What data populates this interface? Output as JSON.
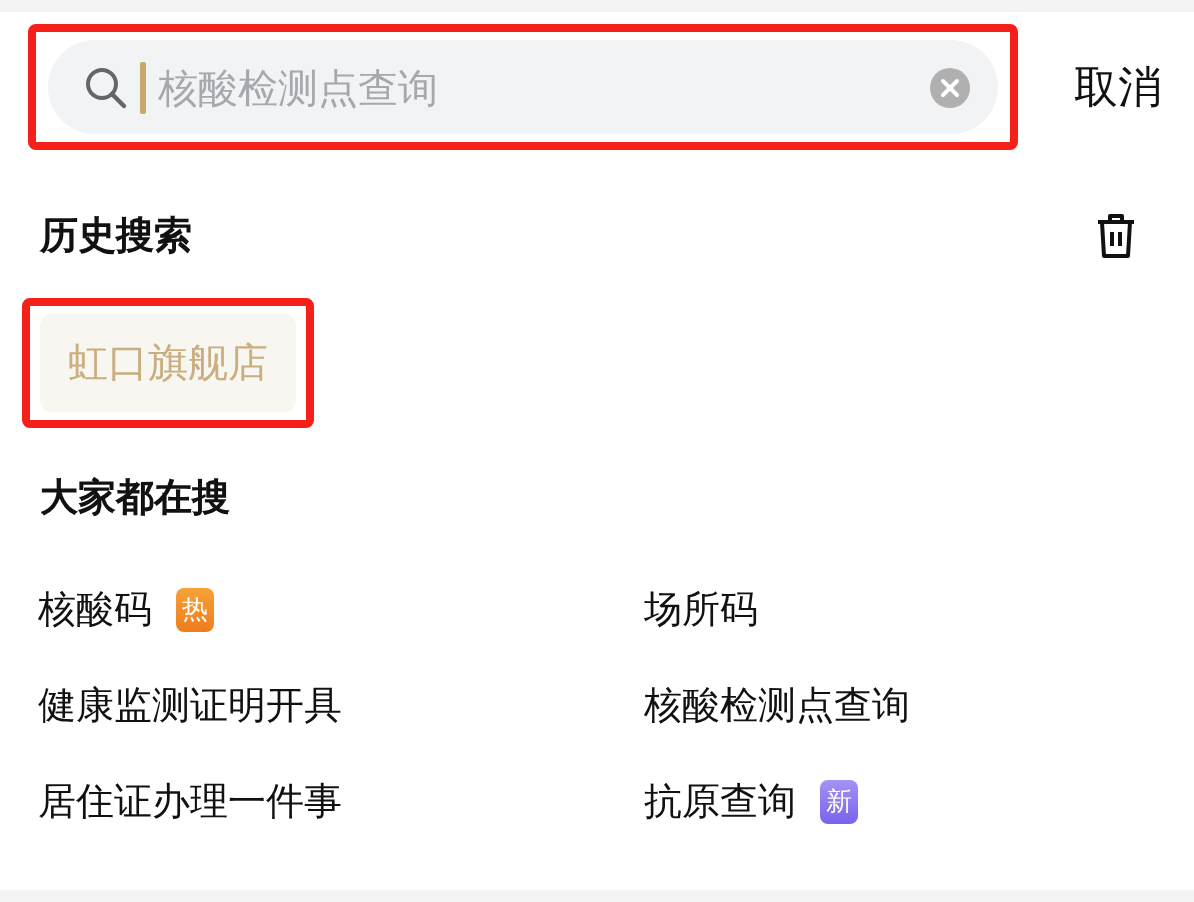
{
  "search": {
    "placeholder": "核酸检测点查询",
    "highlighted": true
  },
  "cancel": "取消",
  "history": {
    "title": "历史搜索",
    "items": [
      {
        "label": "虹口旗舰店",
        "highlighted": true
      }
    ]
  },
  "trending": {
    "title": "大家都在搜",
    "items": [
      {
        "label": "核酸码",
        "badge": {
          "text": "热",
          "kind": "hot"
        }
      },
      {
        "label": "场所码"
      },
      {
        "label": "健康监测证明开具"
      },
      {
        "label": "核酸检测点查询"
      },
      {
        "label": "居住证办理一件事"
      },
      {
        "label": "抗原查询",
        "badge": {
          "text": "新",
          "kind": "new"
        }
      }
    ]
  }
}
